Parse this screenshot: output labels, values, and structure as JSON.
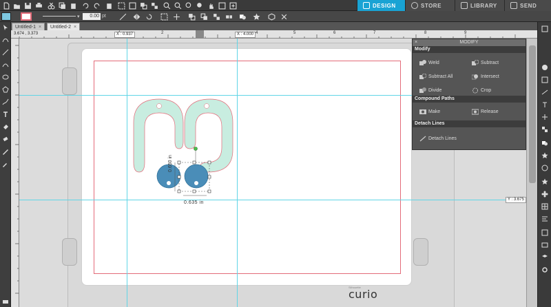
{
  "top_nav": {
    "design": "DESIGN",
    "store": "STORE",
    "library": "LIBRARY",
    "send": "SEND"
  },
  "toolbar2": {
    "line_width": "0.00",
    "line_unit": "pt"
  },
  "tabs": [
    {
      "label": "Untitled-1",
      "active": false
    },
    {
      "label": "Untitled-2",
      "active": true
    }
  ],
  "rulers": {
    "cursor_xy": "3.674 , 3.373",
    "guide_x1": "X : 0.937",
    "guide_x2": "X : 4.000",
    "guide_y": "Y : 3.675",
    "h_ticks": [
      "1",
      "2",
      "3",
      "4",
      "5",
      "6",
      "7",
      "8",
      "9"
    ]
  },
  "canvas": {
    "height_dim": "0.650 in",
    "width_dim": "0.635 in",
    "brand": "curio",
    "brand_small": "Silhouette"
  },
  "modify_panel": {
    "title": "MODIFY",
    "modify_header": "Modify",
    "weld": "Weld",
    "subtract": "Subtract",
    "subtract_all": "Subtract All",
    "intersect": "Intersect",
    "divide": "Divide",
    "crop": "Crop",
    "compound_header": "Compound Paths",
    "make": "Make",
    "release": "Release",
    "detach_header": "Detach Lines",
    "detach_lines": "Detach Lines"
  },
  "colors": {
    "accent": "#19a3d4",
    "shape_fill": "#c8ede0",
    "circle_fill": "#4a8db8",
    "cut_line": "#e36a78",
    "guide": "#5fd5e6"
  }
}
